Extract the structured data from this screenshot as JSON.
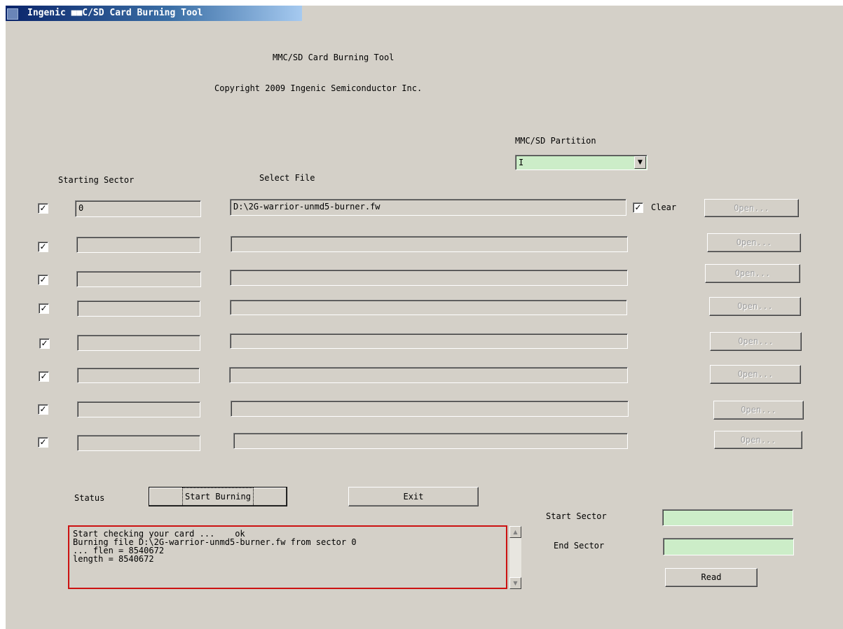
{
  "window": {
    "title": "Ingenic ■■C/SD Card Burning Tool"
  },
  "header": {
    "app_name": "MMC/SD Card Burning Tool",
    "copyright": "Copyright 2009 Ingenic Semiconductor Inc."
  },
  "partition": {
    "label": "MMC/SD Partition",
    "value": "I"
  },
  "columns": {
    "starting_sector": "Starting Sector",
    "select_file": "Select File"
  },
  "rows": [
    {
      "checked": true,
      "sector": "0",
      "file": "D:\\2G-warrior-unmd5-burner.fw",
      "open_label": "Open..."
    },
    {
      "checked": true,
      "sector": "",
      "file": "",
      "open_label": "Open..."
    },
    {
      "checked": true,
      "sector": "",
      "file": "",
      "open_label": "Open..."
    },
    {
      "checked": true,
      "sector": "",
      "file": "",
      "open_label": "Open..."
    },
    {
      "checked": true,
      "sector": "",
      "file": "",
      "open_label": "Open..."
    },
    {
      "checked": true,
      "sector": "",
      "file": "",
      "open_label": "Open..."
    },
    {
      "checked": true,
      "sector": "",
      "file": "",
      "open_label": "Open..."
    },
    {
      "checked": true,
      "sector": "",
      "file": "",
      "open_label": "Open..."
    }
  ],
  "clear": {
    "checked": true,
    "label": "Clear"
  },
  "status_label": "Status",
  "buttons": {
    "start_burning": "Start Burning",
    "exit": "Exit",
    "read": "Read"
  },
  "log": {
    "text": "Start checking your card ...    ok\nBurning file D:\\2G-warrior-unmd5-burner.fw from sector 0\n... flen = 8540672\nlength = 8540672"
  },
  "read_panel": {
    "start_sector_label": "Start Sector",
    "start_sector_value": "",
    "end_sector_label": "End Sector",
    "end_sector_value": ""
  },
  "colors": {
    "dialog_bg": "#d4d0c8",
    "green_field": "#ccedc8",
    "log_border": "#cc1111"
  }
}
